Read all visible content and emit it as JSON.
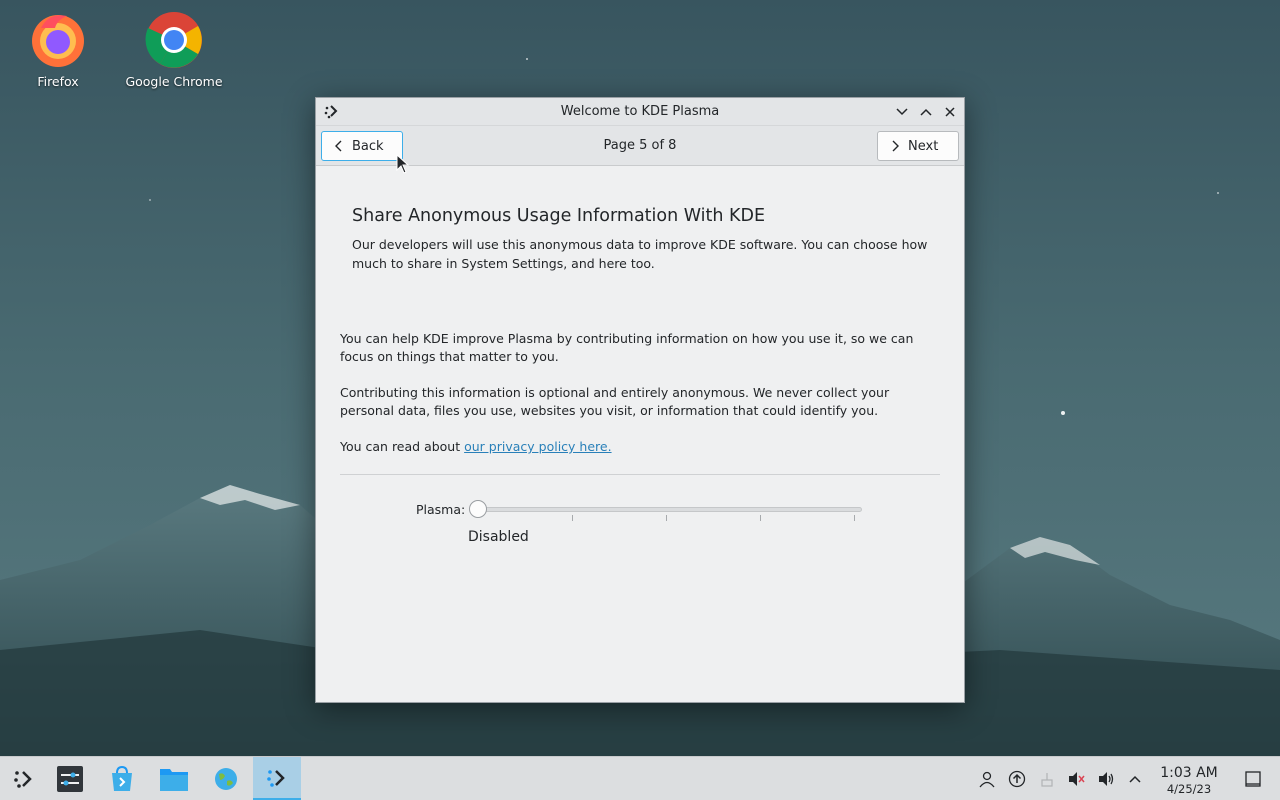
{
  "desktop": {
    "icons": [
      {
        "label": "Firefox",
        "icon": "firefox-icon"
      },
      {
        "label": "Google Chrome",
        "icon": "chrome-icon"
      }
    ]
  },
  "window": {
    "title": "Welcome to KDE Plasma",
    "toolbar": {
      "back_label": "Back",
      "next_label": "Next",
      "page_indicator": "Page 5 of 8"
    },
    "content": {
      "heading": "Share Anonymous Usage Information With KDE",
      "subtitle": "Our developers will use this anonymous data to improve KDE software. You can choose how much to share in System Settings, and here too.",
      "para1": "You can help KDE improve Plasma by contributing information on how you use it, so we can focus on things that matter to you.",
      "para2": "Contributing this information is optional and entirely anonymous. We never collect your personal data, files you use, websites you visit, or information that could identify you.",
      "para3_prefix": "You can read about ",
      "privacy_link": "our privacy policy here.",
      "slider": {
        "label": "Plasma:",
        "value_text": "Disabled",
        "level": 0,
        "steps": 5
      }
    }
  },
  "taskbar": {
    "items": [
      "app-launcher-icon",
      "system-settings-icon",
      "discover-icon",
      "dolphin-icon",
      "globe-icon",
      "welcome-center-icon"
    ],
    "tray": [
      "user-icon",
      "update-icon",
      "network-icon",
      "muted-speaker-icon",
      "volume-icon",
      "expand-tray-icon"
    ],
    "clock": {
      "time": "1:03 AM",
      "date": "4/25/23"
    }
  },
  "colors": {
    "accent": "#3daee9",
    "link": "#2980b9",
    "window_bg": "#eff0f1"
  }
}
